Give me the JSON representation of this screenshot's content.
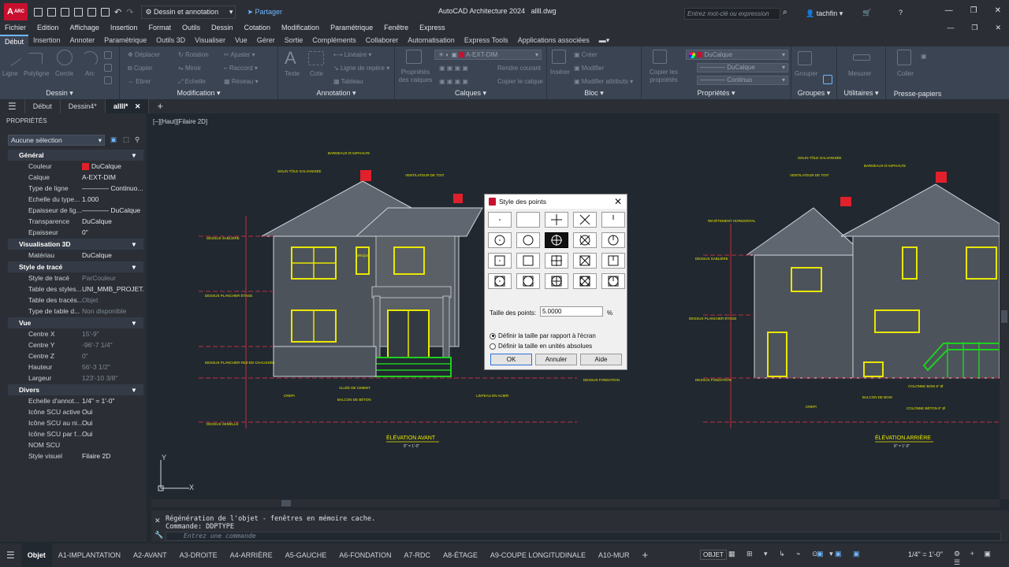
{
  "app": {
    "title": "AutoCAD Architecture 2024",
    "filename": "allll.dwg",
    "app_button": "A",
    "app_badge": "ARC",
    "workspace": "Dessin et annotation",
    "share": "Partager",
    "search_placeholder": "Entrez mot-clé ou expression",
    "user": "tachfin"
  },
  "menu": [
    "Fichier",
    "Edition",
    "Affichage",
    "Insertion",
    "Format",
    "Outils",
    "Dessin",
    "Cotation",
    "Modification",
    "Paramétrique",
    "Fenêtre",
    "Express"
  ],
  "ribbon_tabs": [
    "Début",
    "Insertion",
    "Annoter",
    "Paramétrique",
    "Outils 3D",
    "Visualiser",
    "Vue",
    "Gérer",
    "Sortie",
    "Compléments",
    "Collaborer",
    "Automatisation",
    "Express Tools",
    "Applications associées"
  ],
  "ribbon_panels": {
    "dessin": {
      "label": "Dessin ▾",
      "tools": [
        "Ligne",
        "Polyligne",
        "Cercle",
        "Arc"
      ]
    },
    "modification": {
      "label": "Modification ▾",
      "tools": [
        "Déplacer",
        "Rotation",
        "Ajuster",
        "Copier",
        "Miroir",
        "Raccord",
        "Etirer",
        "Echelle",
        "Réseau"
      ]
    },
    "annotation": {
      "label": "Annotation ▾",
      "tools": [
        "Texte",
        "Cote",
        "Linéaire",
        "Ligne de repère",
        "Tableau"
      ]
    },
    "calques": {
      "label": "Calques ▾",
      "tools": [
        "Propriétés des calques",
        "Rendre courant",
        "Copier le calque"
      ],
      "current": "A-EXT-DIM"
    },
    "bloc": {
      "label": "Bloc ▾",
      "tools": [
        "Insérer",
        "Créer",
        "Modifier",
        "Modifier attributs"
      ]
    },
    "proprietes": {
      "label": "Propriétés ▾",
      "tools": [
        "Copier les propriétés"
      ],
      "color": "DuCalque",
      "lineweight": "DuCalque",
      "linetype": "Continuo"
    },
    "groupes": {
      "label": "Groupes ▾",
      "tools": [
        "Grouper"
      ]
    },
    "utilitaires": {
      "label": "Utilitaires ▾",
      "tools": [
        "Mesurer"
      ]
    },
    "pressepapiers": {
      "label": "Presse-papiers",
      "tools": [
        "Coller"
      ]
    }
  },
  "file_tabs": [
    "Début",
    "Dessin4*",
    "allll*"
  ],
  "properties": {
    "header": "PROPRIÉTÉS",
    "selection": "Aucune sélection",
    "sections": [
      {
        "title": "Général",
        "rows": [
          {
            "k": "Couleur",
            "v": "DuCalque"
          },
          {
            "k": "Calque",
            "v": "A-EXT-DIM"
          },
          {
            "k": "Type de ligne",
            "v": "———— Continuo..."
          },
          {
            "k": "Echelle du type...",
            "v": "1.000"
          },
          {
            "k": "Epaisseur de lig...",
            "v": "———— DuCalque"
          },
          {
            "k": "Transparence",
            "v": "DuCalque"
          },
          {
            "k": "Epaisseur",
            "v": "0\""
          }
        ]
      },
      {
        "title": "Visualisation 3D",
        "rows": [
          {
            "k": "Matériau",
            "v": "DuCalque"
          }
        ]
      },
      {
        "title": "Style de tracé",
        "rows": [
          {
            "k": "Style de tracé",
            "v": "ParCouleur",
            "dim": true
          },
          {
            "k": "Table des styles...",
            "v": "UNI_MMB_PROJET.ctb"
          },
          {
            "k": "Table des tracés...",
            "v": "Objet",
            "dim": true
          },
          {
            "k": "Type de table d...",
            "v": "Non disponible",
            "dim": true
          }
        ]
      },
      {
        "title": "Vue",
        "rows": [
          {
            "k": "Centre X",
            "v": "15'-9\"",
            "dim": true
          },
          {
            "k": "Centre Y",
            "v": "-96'-7 1/4\"",
            "dim": true
          },
          {
            "k": "Centre Z",
            "v": "0\"",
            "dim": true
          },
          {
            "k": "Hauteur",
            "v": "56'-3 1/2\"",
            "dim": true
          },
          {
            "k": "Largeur",
            "v": "123'-10 3/8\"",
            "dim": true
          }
        ]
      },
      {
        "title": "Divers",
        "rows": [
          {
            "k": "Echelle d'annot...",
            "v": "1/4\" = 1'-0\""
          },
          {
            "k": "Icône SCU active",
            "v": "Oui"
          },
          {
            "k": "Icône SCU au ni...",
            "v": "Oui"
          },
          {
            "k": "Icône SCU par f...",
            "v": "Oui"
          },
          {
            "k": "NOM SCU",
            "v": ""
          },
          {
            "k": "Style visuel",
            "v": "Filaire 2D"
          }
        ]
      }
    ]
  },
  "viewport_label": "[−][Haut][Filaire 2D]",
  "drawing": {
    "front_title": "ÉLÉVATION AVANT",
    "rear_title": "ÉLÉVATION ARRIÈRE",
    "scale": "8\" = 1'-0\"",
    "annotations": [
      "BARDEAUX D'ASPHALTE",
      "SOLIN TÔLE GALVANISÉE",
      "VENTILATEUR DE TOIT",
      "REVÊTEMENT HORIZONTAL",
      "DESSUS SABLIÈRE",
      "DESSUS PLANCHER ÉTAGE",
      "DESSUS PLANCHER REZ-DE-CHAUSSÉE",
      "DESSUS FONDATION",
      "DESSUS SEMELLE",
      "ALLÉE DE CIMENT",
      "BALCON DE BÉTON",
      "LINTEAU EN ACIER",
      "CREPI",
      "BALCON DE BOIS",
      "COLONNE BOIS 6\" Ø",
      "COLONNE BÉTON 6\" Ø",
      "BRIQUE"
    ]
  },
  "dialog": {
    "title": "Style des points",
    "size_label": "Taille des points:",
    "size_value": "5.0000",
    "unit": "%",
    "radio1": "Définir la taille par rapport à l'écran",
    "radio2": "Définir la taille en unités absolues",
    "ok": "OK",
    "cancel": "Annuler",
    "help": "Aide",
    "selected_index": 7
  },
  "command": {
    "line1": "Régénération de l'objet - fenêtres en mémoire cache.",
    "line2": "Commande: DDPTYPE",
    "placeholder": "Entrez une commande"
  },
  "layout_tabs": [
    "Objet",
    "A1-IMPLANTATION",
    "A2-AVANT",
    "A3-DROITE",
    "A4-ARRIÈRE",
    "A5-GAUCHE",
    "A6-FONDATION",
    "A7-RDC",
    "A8-ÉTAGE",
    "A9-COUPE LONGITUDINALE",
    "A10-MUR"
  ],
  "status": {
    "objet": "OBJET",
    "scale": "1/4\" = 1'-0\""
  },
  "colors": {
    "accent": "#6fb7ff",
    "ribbon": "#3b4453",
    "drawing_yellow": "#e8e800",
    "drawing_red": "#e0202a",
    "drawing_green": "#1fd01f"
  }
}
